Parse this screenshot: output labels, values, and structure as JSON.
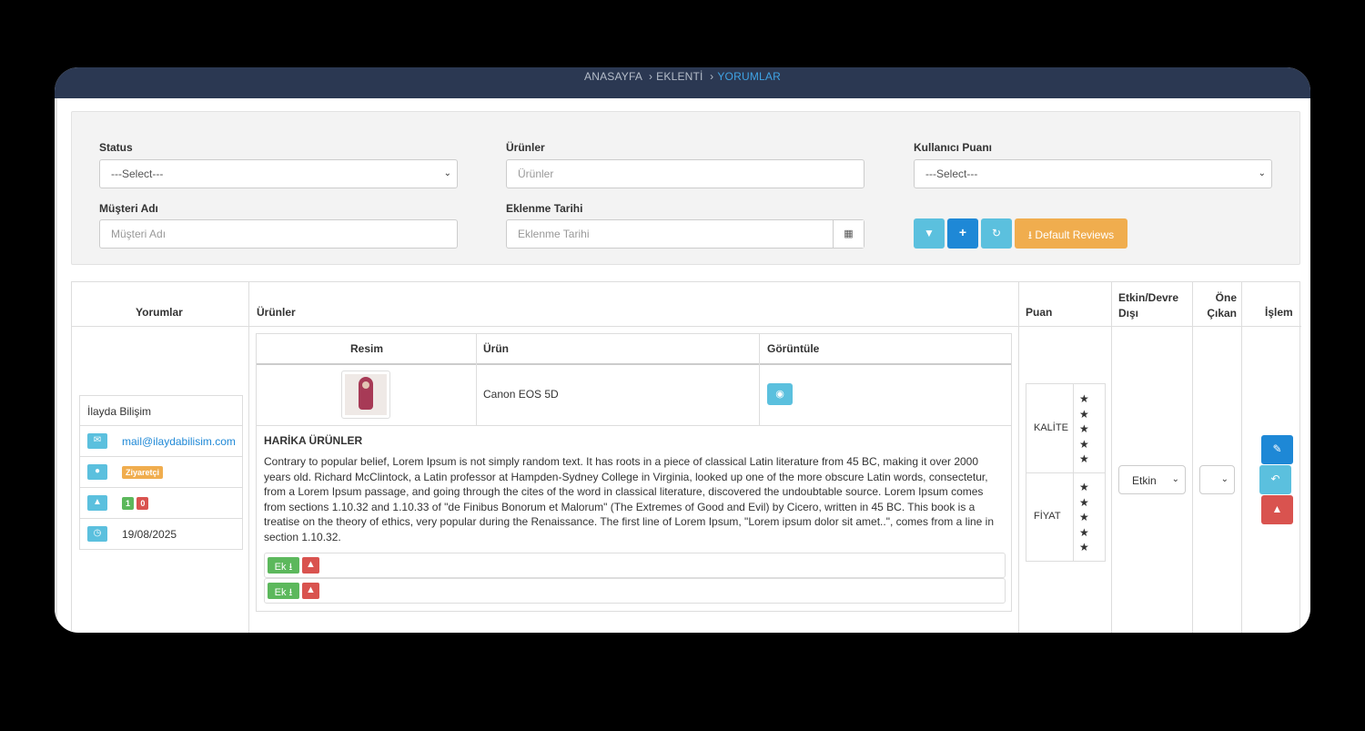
{
  "breadcrumb": {
    "items": [
      "ANASAYFA",
      "EKLENTİ",
      "YORUMLAR"
    ]
  },
  "filters": {
    "status": {
      "label": "Status",
      "value": "---Select---"
    },
    "products": {
      "label": "Ürünler",
      "placeholder": "Ürünler"
    },
    "user_rating": {
      "label": "Kullanıcı Puanı",
      "value": "---Select---"
    },
    "customer_name": {
      "label": "Müşteri Adı",
      "placeholder": "Müşteri Adı"
    },
    "date_added": {
      "label": "Eklenme Tarihi",
      "placeholder": "Eklenme Tarihi"
    },
    "default_reviews_label": "Default Reviews"
  },
  "table": {
    "headers": {
      "reviews": "Yorumlar",
      "products": "Ürünler",
      "rating": "Puan",
      "enabled": "Etkin/Devre Dışı",
      "featured": "Öne Çıkan",
      "actions": "İşlem"
    },
    "row": {
      "customer": {
        "name": "İlayda Bilişim",
        "email": "mail@ilaydabilisim.com",
        "role_badge": "Ziyaretçi",
        "likes": "1",
        "dislikes": "0",
        "date": "19/08/2025"
      },
      "product_table": {
        "headers": {
          "image": "Resim",
          "product": "Ürün",
          "view": "Görüntüle"
        },
        "product_name": "Canon EOS 5D"
      },
      "review_title": "HARİKA ÜRÜNLER",
      "review_text": "Contrary to popular belief, Lorem Ipsum is not simply random text. It has roots in a piece of classical Latin literature from 45 BC, making it over 2000 years old. Richard McClintock, a Latin professor at Hampden-Sydney College in Virginia, looked up one of the more obscure Latin words, consectetur, from a Lorem Ipsum passage, and going through the cites of the word in classical literature, discovered the undoubtable source. Lorem Ipsum comes from sections 1.10.32 and 1.10.33 of \"de Finibus Bonorum et Malorum\" (The Extremes of Good and Evil) by Cicero, written in 45 BC. This book is a treatise on the theory of ethics, very popular during the Renaissance. The first line of Lorem Ipsum, \"Lorem ipsum dolor sit amet..\", comes from a line in section 1.10.32.",
      "attachment_label": "Ek",
      "ratings": [
        {
          "label": "KALİTE",
          "stars": 5
        },
        {
          "label": "FİYAT",
          "stars": 5
        }
      ],
      "enabled_value": "Etkin",
      "featured_value": ""
    }
  },
  "colors": {
    "topbar": "#2b3852",
    "info": "#5bc0de",
    "primary": "#1e88d6",
    "warning": "#f0ad4e",
    "success": "#5cb85c",
    "danger": "#d9534f",
    "link": "#1e88d6"
  }
}
